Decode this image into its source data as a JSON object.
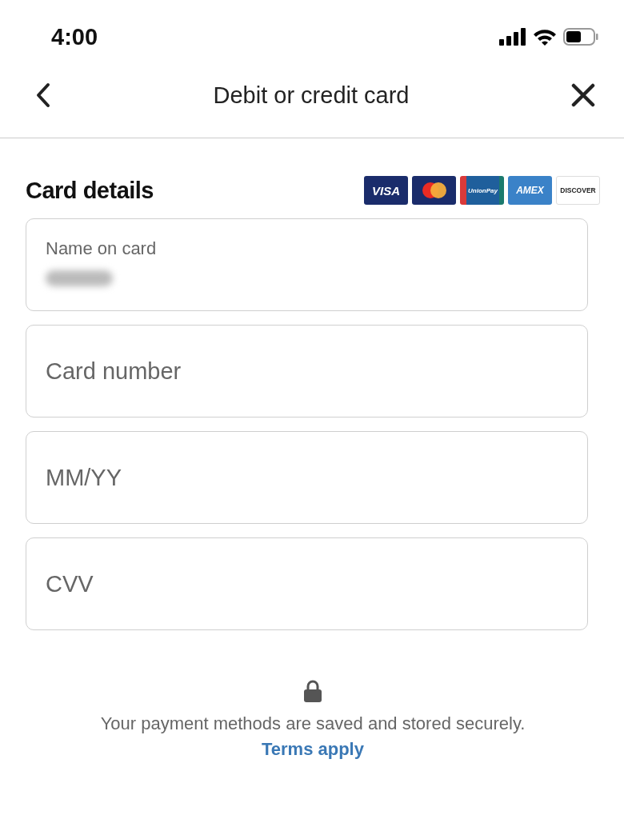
{
  "status_bar": {
    "time": "4:00"
  },
  "header": {
    "title": "Debit or credit card"
  },
  "section": {
    "title": "Card details",
    "card_brands": [
      {
        "kind": "visa",
        "label": "VISA"
      },
      {
        "kind": "mastercard"
      },
      {
        "kind": "unionpay",
        "label": "UnionPay"
      },
      {
        "kind": "amex",
        "label": "AMEX"
      },
      {
        "kind": "discover",
        "label": "DISCOVER"
      }
    ]
  },
  "fields": [
    {
      "kind": "filled",
      "label": "Name on card"
    },
    {
      "kind": "empty",
      "placeholder": "Card number"
    },
    {
      "kind": "empty",
      "placeholder": "MM/YY"
    },
    {
      "kind": "empty",
      "placeholder": "CVV"
    }
  ],
  "footer": {
    "note": "Your payment methods are saved and stored securely.",
    "link": "Terms apply"
  }
}
